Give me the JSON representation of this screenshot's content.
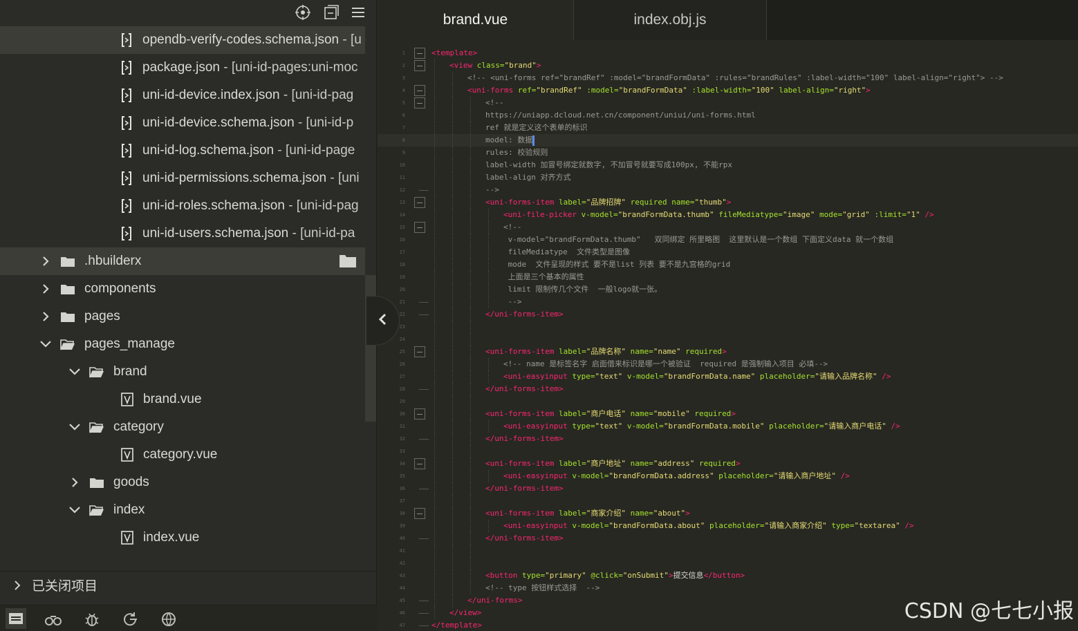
{
  "sidebar": {
    "tree": [
      {
        "type": "file",
        "depth": 4,
        "name": "opendb-verify-codes.schema.json",
        "tag": " - [u",
        "highlight": true,
        "icon": "json-file-icon"
      },
      {
        "type": "file",
        "depth": 4,
        "name": "package.json",
        "tag": " - [uni-id-pages:uni-moc",
        "icon": "json-file-icon"
      },
      {
        "type": "file",
        "depth": 4,
        "name": "uni-id-device.index.json",
        "tag": " - [uni-id-pag",
        "icon": "json-file-icon"
      },
      {
        "type": "file",
        "depth": 4,
        "name": "uni-id-device.schema.json",
        "tag": " - [uni-id-p",
        "icon": "json-file-icon"
      },
      {
        "type": "file",
        "depth": 4,
        "name": "uni-id-log.schema.json",
        "tag": " - [uni-id-page",
        "icon": "json-file-icon"
      },
      {
        "type": "file",
        "depth": 4,
        "name": "uni-id-permissions.schema.json",
        "tag": " - [uni",
        "icon": "json-file-icon"
      },
      {
        "type": "file",
        "depth": 4,
        "name": "uni-id-roles.schema.json",
        "tag": " - [uni-id-pag",
        "icon": "json-file-icon"
      },
      {
        "type": "file",
        "depth": 4,
        "name": "uni-id-users.schema.json",
        "tag": " - [uni-id-pa",
        "icon": "json-file-icon"
      },
      {
        "type": "folder",
        "depth": 1,
        "name": ".hbuilderx",
        "open": false,
        "highlight": true,
        "action": true
      },
      {
        "type": "folder",
        "depth": 1,
        "name": "components",
        "open": false
      },
      {
        "type": "folder",
        "depth": 1,
        "name": "pages",
        "open": false
      },
      {
        "type": "folder",
        "depth": 1,
        "name": "pages_manage",
        "open": true
      },
      {
        "type": "folder",
        "depth": 2,
        "name": "brand",
        "open": true
      },
      {
        "type": "file",
        "depth": 3,
        "name": "brand.vue",
        "icon": "vue-file-icon"
      },
      {
        "type": "folder",
        "depth": 2,
        "name": "category",
        "open": true
      },
      {
        "type": "file",
        "depth": 3,
        "name": "category.vue",
        "icon": "vue-file-icon"
      },
      {
        "type": "folder",
        "depth": 2,
        "name": "goods",
        "open": false
      },
      {
        "type": "folder",
        "depth": 2,
        "name": "index",
        "open": true
      },
      {
        "type": "file",
        "depth": 3,
        "name": "index.vue",
        "icon": "vue-file-icon"
      }
    ],
    "closed_projects_label": "已关闭项目",
    "toolbar_icons": [
      "locate-icon",
      "collapse-all-icon",
      "menu-icon"
    ],
    "bottom_icons": [
      "project-manager-icon",
      "search-icon",
      "debug-icon",
      "refresh-run-icon",
      "browser-icon"
    ]
  },
  "editor": {
    "tabs": [
      {
        "label": "brand.vue",
        "active": true
      },
      {
        "label": "index.obj.js",
        "active": false
      }
    ],
    "current_line": 8,
    "lines": [
      {
        "n": "1",
        "i": 0,
        "fold": "open",
        "tokens": [
          [
            "t",
            "<template>"
          ]
        ]
      },
      {
        "n": "2",
        "i": 1,
        "fold": "open",
        "tokens": [
          [
            "t",
            "<view "
          ],
          [
            "a",
            "class="
          ],
          [
            "s",
            "\"brand\""
          ],
          [
            "t",
            ">"
          ]
        ]
      },
      {
        "n": "3",
        "i": 2,
        "tokens": [
          [
            "c",
            "<!-- <uni-forms ref=\"brandRef\" :model=\"brandFormData\" :rules=\"brandRules\" :label-width=\"100\" label-align=\"right\"> -->"
          ]
        ]
      },
      {
        "n": "4",
        "i": 2,
        "fold": "open",
        "tokens": [
          [
            "t",
            "<uni-forms "
          ],
          [
            "a",
            "ref="
          ],
          [
            "s",
            "\"brandRef\" "
          ],
          [
            "a",
            ":model="
          ],
          [
            "s",
            "\"brandFormData\" "
          ],
          [
            "a",
            ":label-width="
          ],
          [
            "s",
            "\"100\" "
          ],
          [
            "a",
            "label-align="
          ],
          [
            "s",
            "\"right\""
          ],
          [
            "t",
            ">"
          ]
        ]
      },
      {
        "n": "5",
        "i": 3,
        "fold": "open",
        "tokens": [
          [
            "c",
            "<!--"
          ]
        ]
      },
      {
        "n": "6",
        "i": 3,
        "tokens": [
          [
            "c",
            "https://uniapp.dcloud.net.cn/component/uniui/uni-forms.html"
          ]
        ]
      },
      {
        "n": "7",
        "i": 3,
        "tokens": [
          [
            "c",
            "ref 就是定义这个表单的标识"
          ]
        ]
      },
      {
        "n": "8",
        "i": 3,
        "tokens": [
          [
            "c",
            "model: 数据"
          ]
        ],
        "cursor": true
      },
      {
        "n": "9",
        "i": 3,
        "tokens": [
          [
            "c",
            "rules: 校验规则"
          ]
        ]
      },
      {
        "n": "10",
        "i": 3,
        "tokens": [
          [
            "c",
            "label-width 加冒号绑定就数字, 不加冒号就要写成100px, 不能rpx"
          ]
        ]
      },
      {
        "n": "11",
        "i": 3,
        "tokens": [
          [
            "c",
            "label-align 对齐方式"
          ]
        ]
      },
      {
        "n": "12",
        "i": 3,
        "fold": "end",
        "tokens": [
          [
            "c",
            "-->"
          ]
        ]
      },
      {
        "n": "13",
        "i": 3,
        "fold": "open",
        "tokens": [
          [
            "t",
            "<uni-forms-item "
          ],
          [
            "a",
            "label="
          ],
          [
            "s",
            "\"品牌招牌\" "
          ],
          [
            "a",
            "required "
          ],
          [
            "a",
            "name="
          ],
          [
            "s",
            "\"thumb\""
          ],
          [
            "t",
            ">"
          ]
        ]
      },
      {
        "n": "14",
        "i": 4,
        "tokens": [
          [
            "t",
            "<uni-file-picker "
          ],
          [
            "a",
            "v-model="
          ],
          [
            "s",
            "\"brandFormData.thumb\" "
          ],
          [
            "a",
            "fileMediatype="
          ],
          [
            "s",
            "\"image\" "
          ],
          [
            "a",
            "mode="
          ],
          [
            "s",
            "\"grid\" "
          ],
          [
            "a",
            ":limit="
          ],
          [
            "s",
            "\"1\" "
          ],
          [
            "t",
            "/>"
          ]
        ]
      },
      {
        "n": "15",
        "i": 4,
        "fold": "open",
        "tokens": [
          [
            "c",
            "<!--"
          ]
        ]
      },
      {
        "n": "16",
        "i": 4,
        "tokens": [
          [
            "c",
            " v-model=\"brandFormData.thumb\"   双同绑定 所里略图  这里默认是一个数组 下面定义data 就一个数组"
          ]
        ]
      },
      {
        "n": "17",
        "i": 4,
        "tokens": [
          [
            "c",
            " fileMediatype  文件类型是图像"
          ]
        ]
      },
      {
        "n": "18",
        "i": 4,
        "tokens": [
          [
            "c",
            " mode  文件呈现的样式 要不是list 列表 要不是九宫格的grid"
          ]
        ]
      },
      {
        "n": "19",
        "i": 4,
        "tokens": [
          [
            "c",
            " 上面是三个基本的属性"
          ]
        ]
      },
      {
        "n": "20",
        "i": 4,
        "tokens": [
          [
            "c",
            " limit 限制传几个文件  一般logo就一张。"
          ]
        ]
      },
      {
        "n": "21",
        "i": 4,
        "fold": "end",
        "tokens": [
          [
            "c",
            " -->"
          ]
        ]
      },
      {
        "n": "22",
        "i": 3,
        "fold": "end",
        "tokens": [
          [
            "t",
            "</uni-forms-item>"
          ]
        ]
      },
      {
        "n": "23",
        "i": 3,
        "tokens": []
      },
      {
        "n": "24",
        "i": 3,
        "tokens": []
      },
      {
        "n": "25",
        "i": 3,
        "fold": "open",
        "tokens": [
          [
            "t",
            "<uni-forms-item "
          ],
          [
            "a",
            "label="
          ],
          [
            "s",
            "\"品牌名称\" "
          ],
          [
            "a",
            "name="
          ],
          [
            "s",
            "\"name\" "
          ],
          [
            "a",
            "required"
          ],
          [
            "t",
            ">"
          ]
        ]
      },
      {
        "n": "26",
        "i": 4,
        "tokens": [
          [
            "c",
            "<!-- name 是标签名字 启面借来标识是哪一个被验证  required 是强制输入项目 必填-->"
          ]
        ]
      },
      {
        "n": "27",
        "i": 4,
        "tokens": [
          [
            "t",
            "<uni-easyinput "
          ],
          [
            "a",
            "type="
          ],
          [
            "s",
            "\"text\" "
          ],
          [
            "a",
            "v-model="
          ],
          [
            "s",
            "\"brandFormData.name\" "
          ],
          [
            "a",
            "placeholder="
          ],
          [
            "s",
            "\"请输入品牌名称\" "
          ],
          [
            "t",
            "/>"
          ]
        ]
      },
      {
        "n": "28",
        "i": 3,
        "fold": "end",
        "tokens": [
          [
            "t",
            "</uni-forms-item>"
          ]
        ]
      },
      {
        "n": "29",
        "i": 3,
        "tokens": []
      },
      {
        "n": "30",
        "i": 3,
        "fold": "open",
        "tokens": [
          [
            "t",
            "<uni-forms-item "
          ],
          [
            "a",
            "label="
          ],
          [
            "s",
            "\"商户电话\" "
          ],
          [
            "a",
            "name="
          ],
          [
            "s",
            "\"mobile\" "
          ],
          [
            "a",
            "required"
          ],
          [
            "t",
            ">"
          ]
        ]
      },
      {
        "n": "31",
        "i": 4,
        "tokens": [
          [
            "t",
            "<uni-easyinput "
          ],
          [
            "a",
            "type="
          ],
          [
            "s",
            "\"text\" "
          ],
          [
            "a",
            "v-model="
          ],
          [
            "s",
            "\"brandFormData.mobile\" "
          ],
          [
            "a",
            "placeholder="
          ],
          [
            "s",
            "\"请输入商户电话\" "
          ],
          [
            "t",
            "/>"
          ]
        ]
      },
      {
        "n": "32",
        "i": 3,
        "fold": "end",
        "tokens": [
          [
            "t",
            "</uni-forms-item>"
          ]
        ]
      },
      {
        "n": "33",
        "i": 3,
        "tokens": []
      },
      {
        "n": "34",
        "i": 3,
        "fold": "open",
        "tokens": [
          [
            "t",
            "<uni-forms-item "
          ],
          [
            "a",
            "label="
          ],
          [
            "s",
            "\"商户地址\" "
          ],
          [
            "a",
            "name="
          ],
          [
            "s",
            "\"address\" "
          ],
          [
            "a",
            "required"
          ],
          [
            "t",
            ">"
          ]
        ]
      },
      {
        "n": "35",
        "i": 4,
        "tokens": [
          [
            "t",
            "<uni-easyinput "
          ],
          [
            "a",
            "v-model="
          ],
          [
            "s",
            "\"brandFormData.address\" "
          ],
          [
            "a",
            "placeholder="
          ],
          [
            "s",
            "\"请输入商户地址\" "
          ],
          [
            "t",
            "/>"
          ]
        ]
      },
      {
        "n": "36",
        "i": 3,
        "fold": "end",
        "tokens": [
          [
            "t",
            "</uni-forms-item>"
          ]
        ]
      },
      {
        "n": "37",
        "i": 3,
        "tokens": []
      },
      {
        "n": "38",
        "i": 3,
        "fold": "open",
        "tokens": [
          [
            "t",
            "<uni-forms-item "
          ],
          [
            "a",
            "label="
          ],
          [
            "s",
            "\"商家介绍\" "
          ],
          [
            "a",
            "name="
          ],
          [
            "s",
            "\"about\""
          ],
          [
            "t",
            ">"
          ]
        ]
      },
      {
        "n": "39",
        "i": 4,
        "tokens": [
          [
            "t",
            "<uni-easyinput "
          ],
          [
            "a",
            "v-model="
          ],
          [
            "s",
            "\"brandFormData.about\" "
          ],
          [
            "a",
            "placeholder="
          ],
          [
            "s",
            "\"请输入商家介绍\" "
          ],
          [
            "a",
            "type="
          ],
          [
            "s",
            "\"textarea\" "
          ],
          [
            "t",
            "/>"
          ]
        ]
      },
      {
        "n": "40",
        "i": 3,
        "fold": "end",
        "tokens": [
          [
            "t",
            "</uni-forms-item>"
          ]
        ]
      },
      {
        "n": "41",
        "i": 3,
        "tokens": []
      },
      {
        "n": "42",
        "i": 3,
        "tokens": []
      },
      {
        "n": "43",
        "i": 3,
        "tokens": [
          [
            "t",
            "<button "
          ],
          [
            "a",
            "type="
          ],
          [
            "s",
            "\"primary\" "
          ],
          [
            "a",
            "@click="
          ],
          [
            "s",
            "\"onSubmit\""
          ],
          [
            "t",
            ">"
          ],
          [
            "p",
            "提交信息"
          ],
          [
            "t",
            "</button>"
          ]
        ]
      },
      {
        "n": "44",
        "i": 3,
        "tokens": [
          [
            "c",
            "<!-- type 按钮样式选择  -->"
          ]
        ]
      },
      {
        "n": "45",
        "i": 2,
        "fold": "end",
        "tokens": [
          [
            "t",
            "</uni-forms>"
          ]
        ]
      },
      {
        "n": "46",
        "i": 1,
        "fold": "end",
        "tokens": [
          [
            "t",
            "</view>"
          ]
        ]
      },
      {
        "n": "47",
        "i": 0,
        "fold": "end",
        "tokens": [
          [
            "t",
            "</template>"
          ]
        ]
      }
    ]
  },
  "watermark": "CSDN @七七小报",
  "colors": {
    "tag": "#f92672",
    "attr": "#a6e22e",
    "string": "#e6db74",
    "comment": "#9a9a92",
    "background": "#272822"
  }
}
